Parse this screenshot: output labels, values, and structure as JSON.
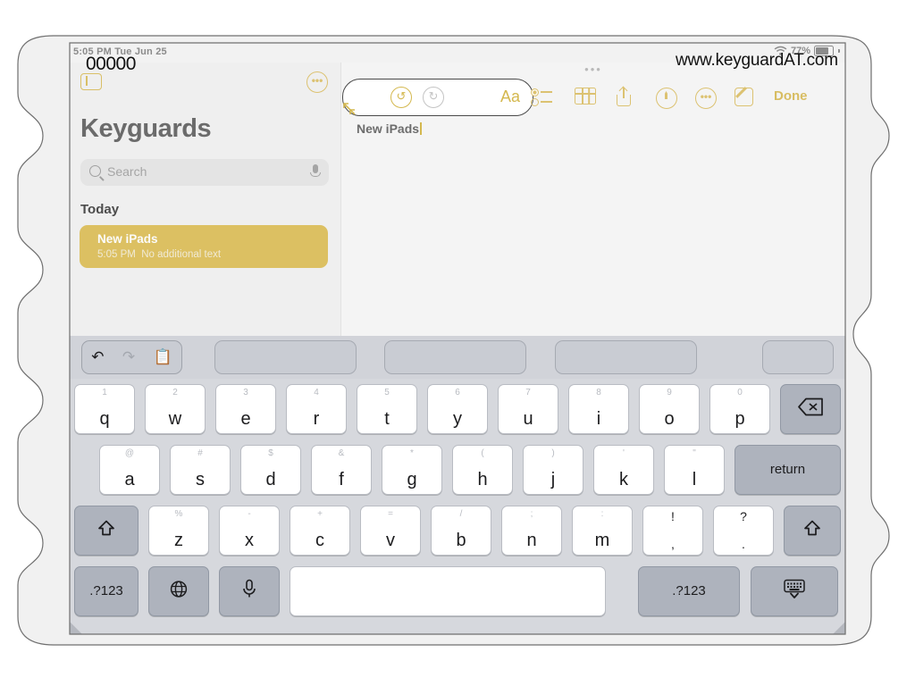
{
  "status_bar": {
    "time_date": "5:05 PM  Tue Jun 25",
    "battery_percent": "77%",
    "wifi_icon": "wifi-icon",
    "battery_icon": "battery-icon"
  },
  "overlays": {
    "watermark": "www.keyguardAT.com",
    "digits": "00000"
  },
  "sidebar": {
    "toggle_icon": "sidebar-toggle-icon",
    "more_icon": "more-circle-icon",
    "title": "Keyguards",
    "search": {
      "placeholder": "Search",
      "icon": "search-icon",
      "mic_icon": "microphone-icon"
    },
    "section_header": "Today",
    "notes": [
      {
        "title": "New iPads",
        "time": "5:05 PM",
        "preview": "No additional text"
      }
    ]
  },
  "editor": {
    "grabber": "•••",
    "format_toolbar": {
      "resize_icon": "resize-arrows-icon",
      "undo_icon": "undo-icon",
      "redo_icon": "redo-icon",
      "text_format_label": "Aa"
    },
    "note_title": "New iPads",
    "icons": [
      {
        "name": "checklist-icon"
      },
      {
        "name": "table-icon"
      },
      {
        "name": "share-icon"
      },
      {
        "name": "markup-pen-icon"
      },
      {
        "name": "more-circle-icon"
      },
      {
        "name": "compose-icon"
      }
    ],
    "done_label": "Done"
  },
  "keyboard": {
    "shortcut_bar": {
      "undo_icon": "undo-icon",
      "redo_icon": "redo-icon",
      "paste_icon": "paste-icon",
      "prediction_slots": [
        "",
        "",
        "",
        ""
      ]
    },
    "rows": [
      [
        {
          "main": "q",
          "alt": "1"
        },
        {
          "main": "w",
          "alt": "2"
        },
        {
          "main": "e",
          "alt": "3"
        },
        {
          "main": "r",
          "alt": "4"
        },
        {
          "main": "t",
          "alt": "5"
        },
        {
          "main": "y",
          "alt": "6"
        },
        {
          "main": "u",
          "alt": "7"
        },
        {
          "main": "i",
          "alt": "8"
        },
        {
          "main": "o",
          "alt": "9"
        },
        {
          "main": "p",
          "alt": "0"
        },
        {
          "main": "",
          "alt": "",
          "icon": "backspace-icon",
          "dark": true,
          "name": "backspace-key"
        }
      ],
      [
        {
          "main": "a",
          "alt": "@"
        },
        {
          "main": "s",
          "alt": "#"
        },
        {
          "main": "d",
          "alt": "$"
        },
        {
          "main": "f",
          "alt": "&"
        },
        {
          "main": "g",
          "alt": "*"
        },
        {
          "main": "h",
          "alt": "("
        },
        {
          "main": "j",
          "alt": ")"
        },
        {
          "main": "k",
          "alt": "'"
        },
        {
          "main": "l",
          "alt": "\""
        },
        {
          "main": "return",
          "alt": "",
          "dark": true,
          "name": "return-key"
        }
      ],
      [
        {
          "main": "",
          "icon": "shift-icon",
          "dark": true,
          "name": "shift-left-key"
        },
        {
          "main": "z",
          "alt": "%"
        },
        {
          "main": "x",
          "alt": "-"
        },
        {
          "main": "c",
          "alt": "+"
        },
        {
          "main": "v",
          "alt": "="
        },
        {
          "main": "b",
          "alt": "/"
        },
        {
          "main": "n",
          "alt": ";"
        },
        {
          "main": "m",
          "alt": ":"
        },
        {
          "stack": "!",
          "stack2": ",",
          "name": "exclam-comma-key"
        },
        {
          "stack": "?",
          "stack2": ".",
          "name": "question-period-key"
        },
        {
          "main": "",
          "icon": "shift-icon",
          "dark": true,
          "name": "shift-right-key"
        }
      ],
      [
        {
          "main": ".?123",
          "dark": true,
          "name": "numbers-left-key"
        },
        {
          "main": "",
          "icon": "globe-icon",
          "dark": true,
          "name": "globe-key"
        },
        {
          "main": "",
          "icon": "microphone-icon",
          "dark": true,
          "name": "dictation-key"
        },
        {
          "main": "",
          "name": "space-key"
        },
        {
          "main": ".?123",
          "dark": true,
          "name": "numbers-right-key"
        },
        {
          "main": "",
          "icon": "hide-keyboard-icon",
          "dark": true,
          "name": "hide-keyboard-key"
        }
      ]
    ]
  },
  "colors": {
    "accent_gold": "#dcc271",
    "note_card": "#dcc062",
    "keyboard_bg": "#d6d8dd",
    "key_dark": "#aeb3bd"
  }
}
